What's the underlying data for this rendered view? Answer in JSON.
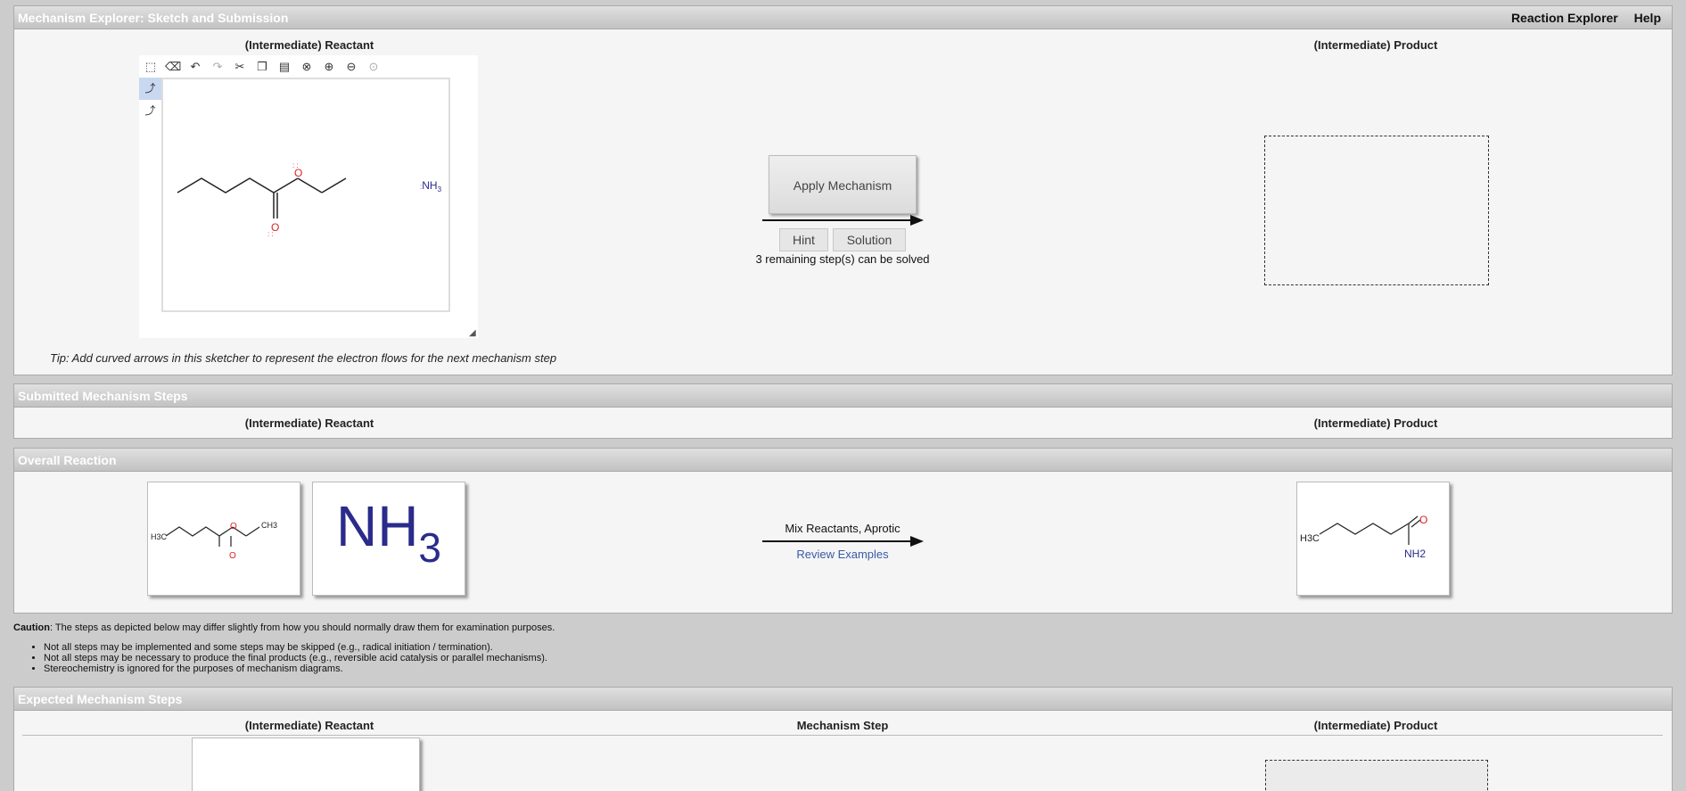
{
  "header": {
    "title": "Mechanism Explorer: Sketch and Submission",
    "nav": [
      "Reaction Explorer",
      "Help"
    ]
  },
  "sketch": {
    "reactant_label": "(Intermediate) Reactant",
    "product_label": "(Intermediate) Product",
    "tip": "Tip: Add curved arrows in this sketcher to represent the electron flows for the next mechanism step",
    "apply_label": "Apply Mechanism",
    "hint_label": "Hint",
    "solution_label": "Solution",
    "remaining_text": "3 remaining step(s) can be solved",
    "canvas_nh3": "NH",
    "canvas_nh3_sub": "3",
    "tools": [
      "select-icon",
      "eraser-icon",
      "undo-icon",
      "redo-icon",
      "cut-icon",
      "copy-icon",
      "paste-icon",
      "zoom-fit-icon",
      "zoom-in-icon",
      "zoom-out-icon",
      "zoom-reset-icon"
    ],
    "side_tools": [
      "arrow-single-icon",
      "arrow-curve-icon"
    ]
  },
  "submitted": {
    "title": "Submitted Mechanism Steps",
    "reactant_label": "(Intermediate) Reactant",
    "product_label": "(Intermediate) Product"
  },
  "overall": {
    "title": "Overall Reaction",
    "conditions": "Mix Reactants, Aprotic",
    "review_label": "Review Examples",
    "nh3_main": "NH",
    "nh3_sub": "3",
    "ester_labels": {
      "h3c": "H3C",
      "ch3": "CH3",
      "o1": "O",
      "o2": "O"
    },
    "amide_labels": {
      "h3c": "H3C",
      "o": "O",
      "nh2": "NH2"
    }
  },
  "caution": {
    "lead": "Caution",
    "text": ": The steps as depicted below may differ slightly from how you should normally draw them for examination purposes.",
    "items": [
      "Not all steps may be implemented and some steps may be skipped (e.g., radical initiation / termination).",
      "Not all steps may be necessary to produce the final products (e.g., reversible acid catalysis or parallel mechanisms).",
      "Stereochemistry is ignored for the purposes of mechanism diagrams."
    ]
  },
  "expected": {
    "title": "Expected Mechanism Steps",
    "reactant_label": "(Intermediate) Reactant",
    "step_label": "Mechanism Step",
    "product_label": "(Intermediate) Product"
  },
  "colors": {
    "header_text": "#ffffff",
    "oxygen": "#dd2222",
    "nitrogen": "#2b2b8c",
    "link": "#3a5aa8"
  }
}
